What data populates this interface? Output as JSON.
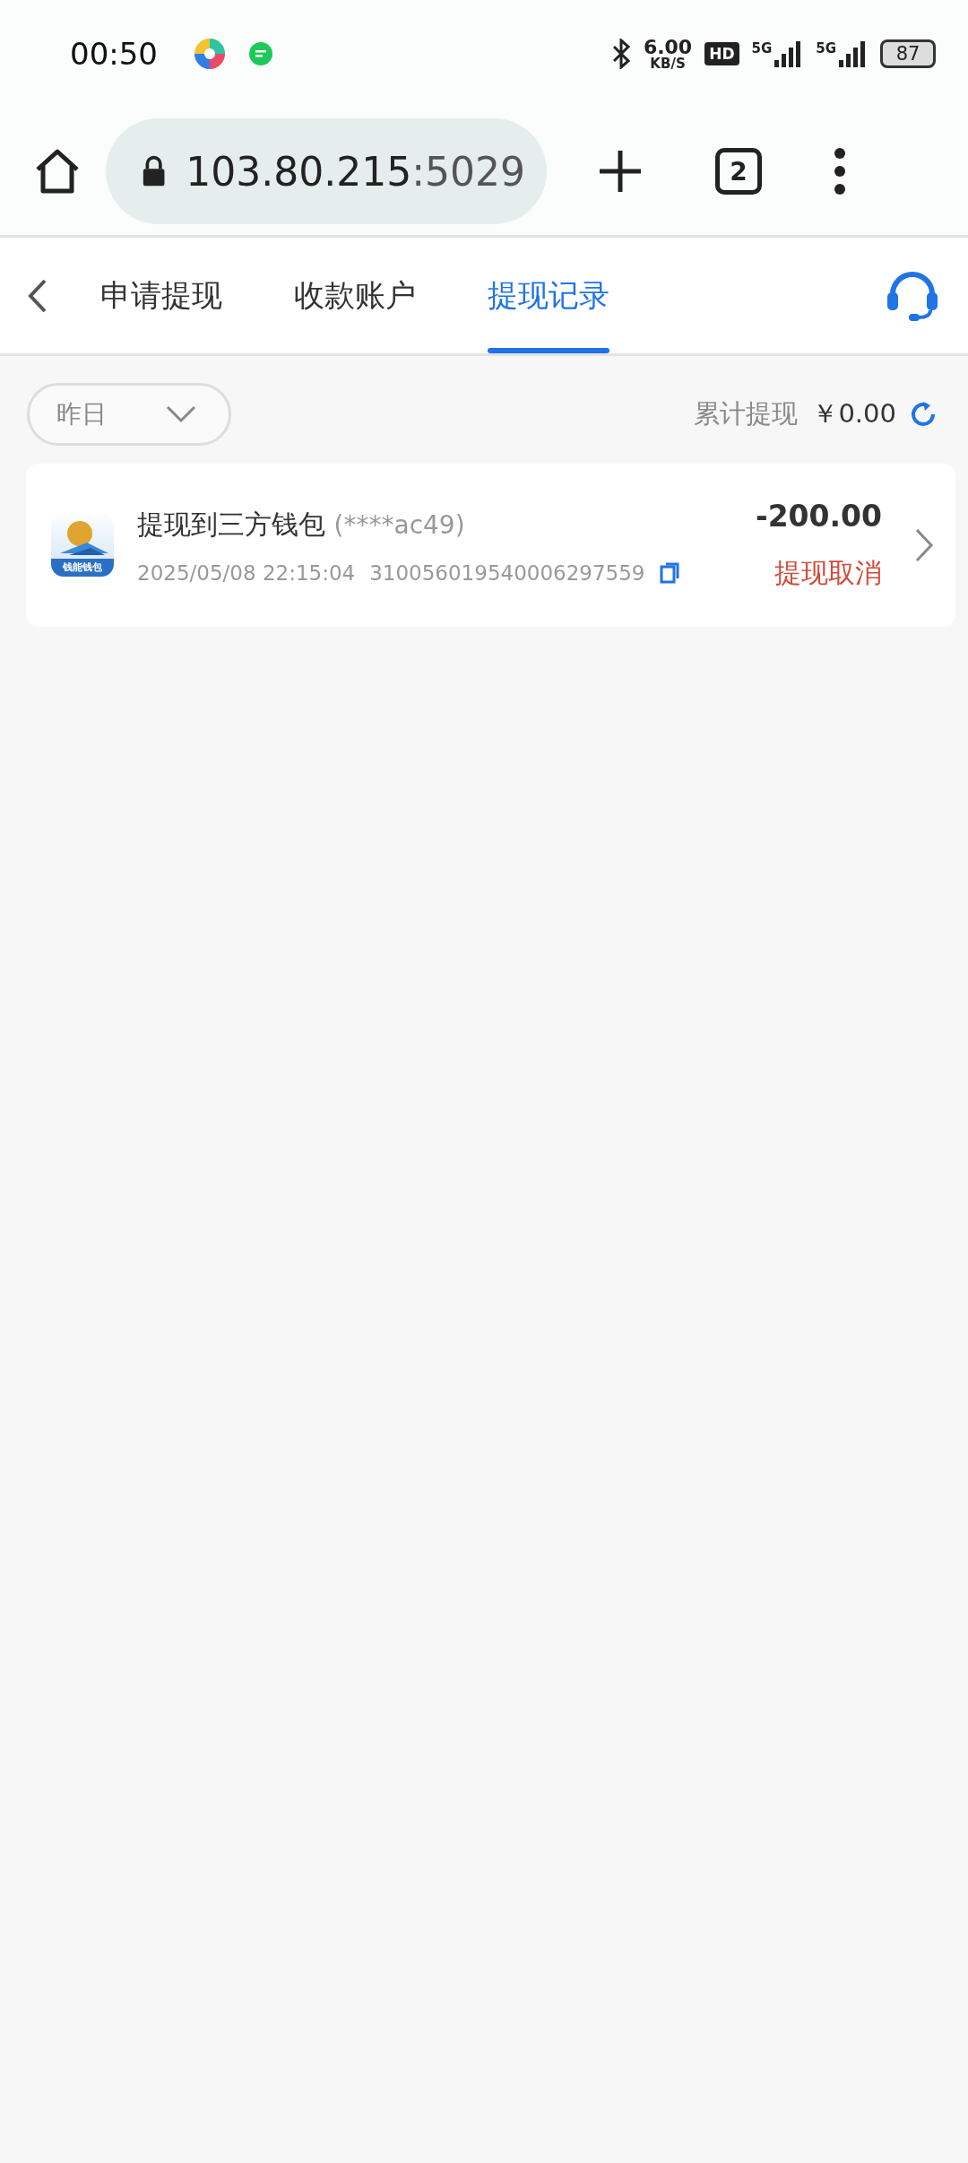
{
  "status_bar": {
    "time": "00:50",
    "speed_value": "6.00",
    "speed_unit": "KB/S",
    "hd_badge": "HD",
    "sim_1": "5G",
    "sim_2": "5G",
    "battery": "87"
  },
  "browser": {
    "url_host": "103.80.215",
    "url_port": ":5029",
    "tab_count": "2"
  },
  "tabs": [
    {
      "label": "申请提现",
      "selected": false
    },
    {
      "label": "收款账户",
      "selected": false
    },
    {
      "label": "提现记录",
      "selected": true
    }
  ],
  "filter": {
    "value": "昨日"
  },
  "total": {
    "label": "累计提现",
    "amount": "￥0.00"
  },
  "records": [
    {
      "logo_text": "钱能钱包",
      "title": "提现到三方钱包",
      "account": "(****ac49)",
      "time": "2025/05/08 22:15:04",
      "order_no": "310056019540006297559",
      "amount": "-200.00",
      "status": "提现取消"
    }
  ]
}
